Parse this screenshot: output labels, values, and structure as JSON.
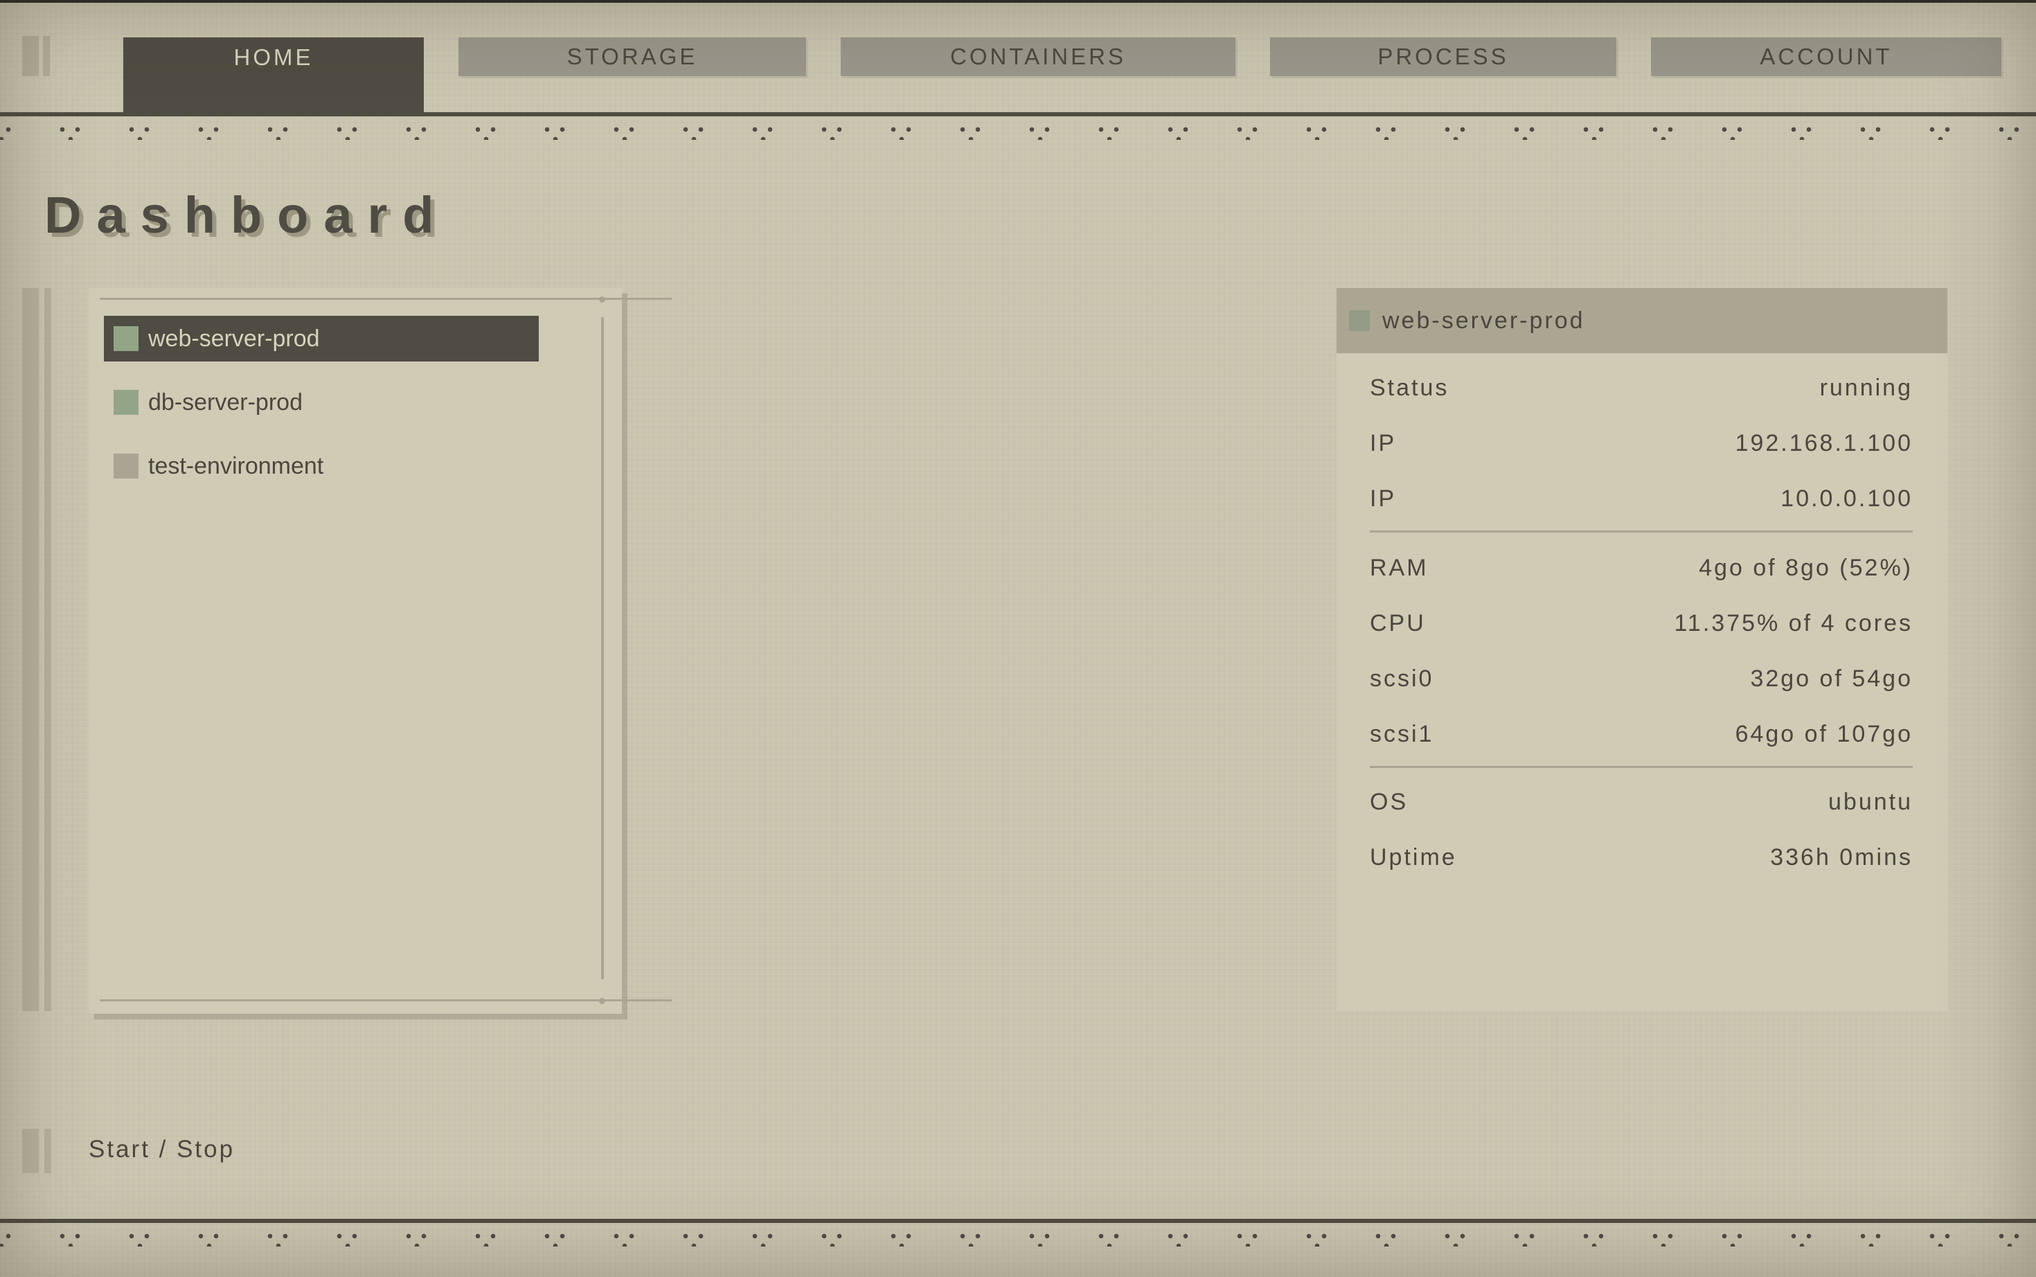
{
  "nav": {
    "tabs": [
      {
        "label": "HOME"
      },
      {
        "label": "STORAGE"
      },
      {
        "label": "CONTAINERS"
      },
      {
        "label": "PROCESS"
      },
      {
        "label": "ACCOUNT"
      }
    ],
    "active_tab": "HOME"
  },
  "page": {
    "title": "Dashboard"
  },
  "servers": [
    {
      "name": "web-server-prod",
      "status": "running",
      "selected": true
    },
    {
      "name": "db-server-prod",
      "status": "running",
      "selected": false
    },
    {
      "name": "test-environment",
      "status": "stopped",
      "selected": false
    }
  ],
  "details": {
    "title": "web-server-prod",
    "rows": [
      {
        "label": "Status",
        "value": "running"
      },
      {
        "label": "IP",
        "value": "192.168.1.100"
      },
      {
        "label": "IP",
        "value": "10.0.0.100"
      },
      {
        "label": "RAM",
        "value": "4go of 8go (52%)"
      },
      {
        "label": "CPU",
        "value": "11.375% of 4 cores"
      },
      {
        "label": "scsi0",
        "value": "32go of 54go"
      },
      {
        "label": "scsi1",
        "value": "64go of 107go"
      },
      {
        "label": "OS",
        "value": "ubuntu"
      },
      {
        "label": "Uptime",
        "value": "336h 0mins"
      }
    ]
  },
  "actions": {
    "start_stop": "Start / Stop"
  },
  "colors": {
    "background": "#cbc6b0",
    "panel": "#d0cbb5",
    "dark": "#4f4c43",
    "running": "#93a487",
    "stopped": "#a9a592"
  }
}
